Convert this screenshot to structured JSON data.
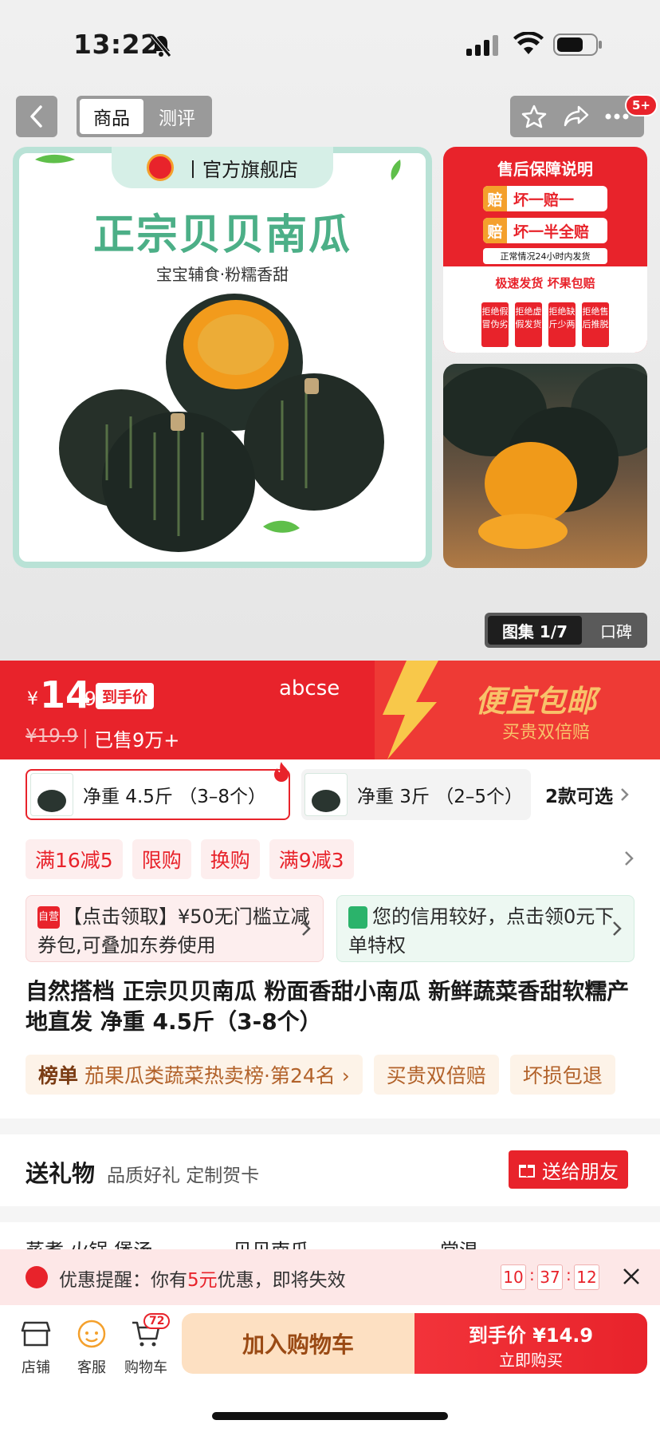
{
  "status": {
    "time": "13:22"
  },
  "nav": {
    "tab_product": "商品",
    "tab_review": "测评",
    "more_badge": "5+"
  },
  "hero": {
    "store_label": "丨官方旗舰店",
    "main_title": "正宗贝贝南瓜",
    "subtitle": "宝宝辅食·粉糯香甜",
    "guarantee": {
      "title": "售后保障说明",
      "row1_tag": "赔",
      "row1_text": "坏一赔一",
      "row2_tag": "赔",
      "row2_text": "坏一半全赔",
      "note": "正常情况24小时内发货",
      "lower_title": "极速发货  坏果包赔",
      "boxes": [
        "拒绝假冒伪劣",
        "拒绝虚假发货",
        "拒绝缺斤少两",
        "拒绝售后推脱"
      ]
    },
    "gallery_label": "图集 1/7",
    "review_label": "口碑"
  },
  "price": {
    "currency": "¥",
    "integer": "14",
    "decimal": ".9",
    "tag": "到手价",
    "original": "¥19.9",
    "sold": "已售9万+",
    "watermark": "abcse",
    "promo_title": "便宜包邮",
    "promo_sub": "买贵双倍赔"
  },
  "variants": {
    "v1_label": "净重 4.5斤 （3–8个）",
    "v2_label": "净重 3斤 （2–5个）",
    "more": "2款可选"
  },
  "chips": [
    "满16减5",
    "限购",
    "换购",
    "满9减3"
  ],
  "coupons": {
    "left_icon": "自营",
    "left_text": "【点击领取】¥50无门槛立减券包,可叠加东券使用",
    "right_text": "您的信用较好，点击领0元下单特权"
  },
  "product_title": "自然搭档 正宗贝贝南瓜 粉面香甜小南瓜 新鲜蔬菜香甜软糯产地直发 净重 4.5斤（3-8个）",
  "rank": {
    "label": "榜单",
    "text": "茄果瓜类蔬菜热卖榜·第24名 ›",
    "tag2": "买贵双倍赔",
    "tag3": "坏损包退"
  },
  "gift": {
    "title": "送礼物",
    "sub": "品质好礼 定制贺卡",
    "button": "送给朋友"
  },
  "params": [
    "蒸煮 火锅 煲汤",
    "贝贝南瓜",
    "常温"
  ],
  "timer": {
    "prefix": "优惠提醒：你有",
    "amount": "5元",
    "suffix": "优惠，即将失效",
    "h": "10",
    "m": "37",
    "s": "12"
  },
  "bottom": {
    "store": "店铺",
    "service": "客服",
    "cart": "购物车",
    "cart_count": "72",
    "add_cart": "加入购物车",
    "buy_price_label": "到手价 ¥14.9",
    "buy_now": "立即购买"
  },
  "colors": {
    "brand_red": "#e8232b",
    "mint": "#b9e2d6",
    "title_green": "#4caf87"
  }
}
